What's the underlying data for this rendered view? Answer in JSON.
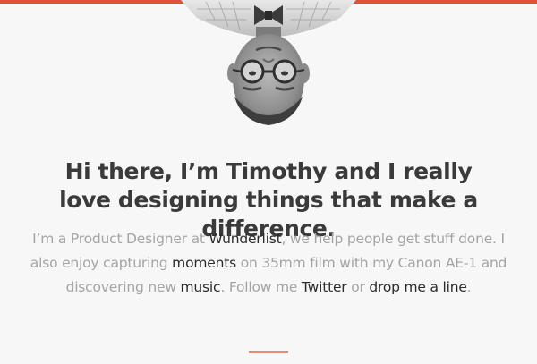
{
  "colors": {
    "accent": "#e0503c",
    "heading": "#3a3a3a",
    "body_text": "#a4a4a4",
    "link_text": "#2b2b2b",
    "background": "#f7f7f7"
  },
  "profile": {
    "avatar_icon": "avatar-portrait-upside-down"
  },
  "hero": {
    "headline": "Hi there, I’m Timothy and I really love designing things that make a difference."
  },
  "intro": {
    "t1": "I’m a Product Designer at ",
    "link_wunderlist": "Wunderlist",
    "t2": ", we help people get stuff done. I also enjoy capturing ",
    "link_moments": "moments",
    "t3": " on 35mm film with my Canon AE-1 and discovering new ",
    "link_music": "music",
    "t4": ". Follow me ",
    "link_twitter": "Twitter",
    "t5": " or ",
    "link_contact": "drop me a line",
    "t6": "."
  }
}
